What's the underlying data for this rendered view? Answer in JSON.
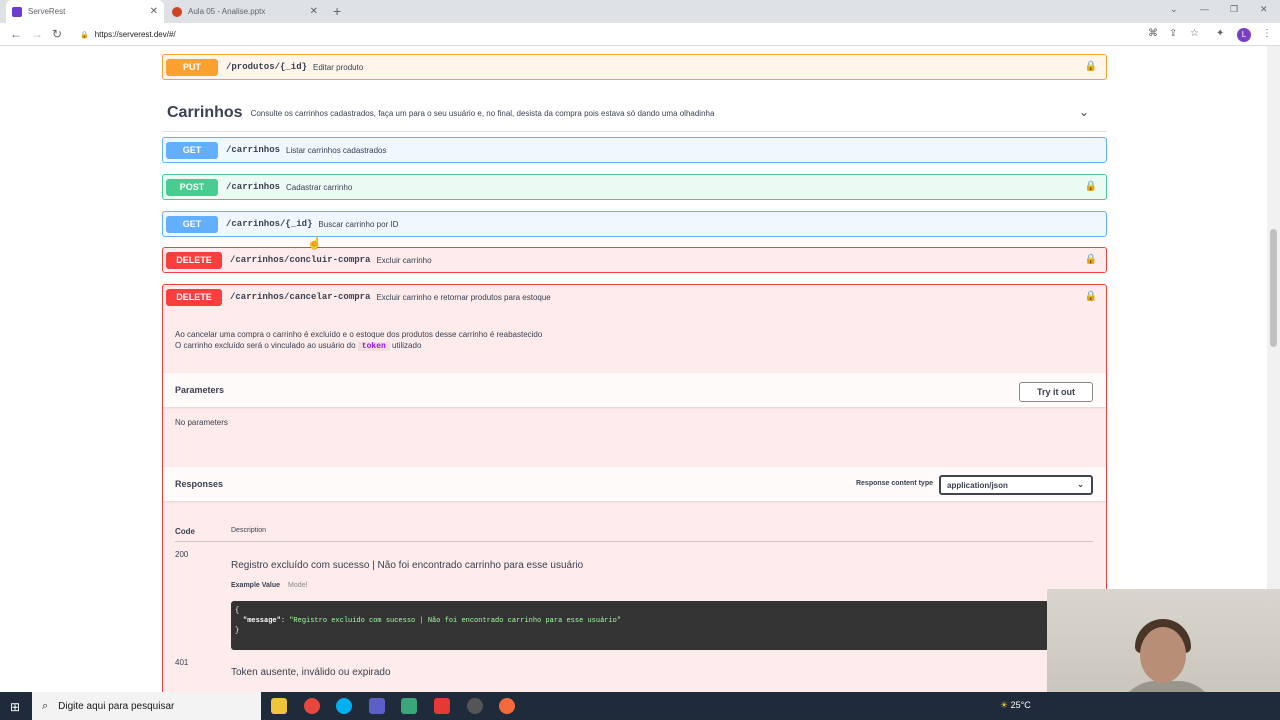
{
  "browser": {
    "tabs": [
      {
        "title": "ServeRest",
        "active": true
      },
      {
        "title": "Aula 05 - Analise.pptx",
        "active": false
      }
    ],
    "url": "https://serverest.dev/#/"
  },
  "endpoints": {
    "put_produtos": {
      "method": "PUT",
      "path": "/produtos/{_id}",
      "description": "Editar produto"
    },
    "get_carrinhos": {
      "method": "GET",
      "path": "/carrinhos",
      "description": "Listar carrinhos cadastrados"
    },
    "post_carrinhos": {
      "method": "POST",
      "path": "/carrinhos",
      "description": "Cadastrar carrinho"
    },
    "get_carrinho_id": {
      "method": "GET",
      "path": "/carrinhos/{_id}",
      "description": "Buscar carrinho por ID"
    },
    "delete_concluir": {
      "method": "DELETE",
      "path": "/carrinhos/concluir-compra",
      "description": "Excluir carrinho"
    },
    "delete_cancelar": {
      "method": "DELETE",
      "path": "/carrinhos/cancelar-compra",
      "description": "Excluir carrinho e retornar produtos para estoque"
    }
  },
  "tag": {
    "title": "Carrinhos",
    "description": "Consulte os carrinhos cadastrados, faça um para o seu usuário e, no final, desista da compra pois estava só dando uma olhadinha"
  },
  "expanded": {
    "desc_line1": "Ao cancelar uma compra o carrinho é excluído e o estoque dos produtos desse carrinho é reabastecido",
    "desc_line2_pre": "O carrinho excluído será o vinculado ao usuário do",
    "desc_line2_code": "token",
    "desc_line2_post": "utilizado",
    "parameters_label": "Parameters",
    "try_it_out": "Try it out",
    "no_parameters": "No parameters",
    "responses_label": "Responses",
    "response_content_type_label": "Response content type",
    "response_content_type_value": "application/json",
    "code_header": "Code",
    "description_header": "Description",
    "responses": [
      {
        "code": "200",
        "text": "Registro excluído com sucesso | Não foi encontrado carrinho para esse usuário"
      },
      {
        "code": "401",
        "text": "Token ausente, inválido ou expirado"
      }
    ],
    "example_value_tab": "Example Value",
    "model_tab": "Model",
    "example_json_key": "\"message\"",
    "example_json_value": "\"Registro excluído com sucesso | Não foi encontrado carrinho para esse usuário\""
  },
  "taskbar": {
    "search_placeholder": "Digite aqui para pesquisar",
    "weather": "25°C"
  }
}
